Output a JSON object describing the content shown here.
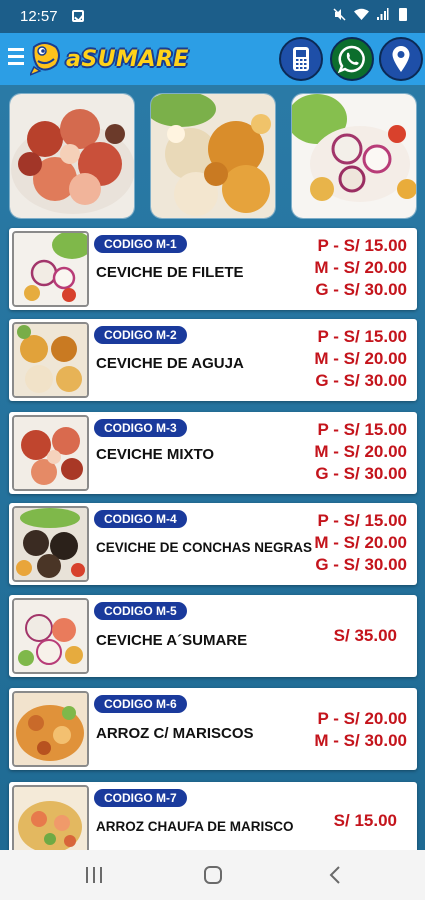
{
  "status_bar": {
    "time": "12:57"
  },
  "app_bar": {
    "logo_text": "aSUMARE",
    "actions": [
      {
        "name": "phone",
        "icon": "mobile-phone-icon"
      },
      {
        "name": "whatsapp",
        "icon": "whatsapp-icon"
      },
      {
        "name": "location",
        "icon": "map-pin-icon"
      }
    ]
  },
  "colors": {
    "app_bar": "#2c9ee5",
    "background": "#1f6a93",
    "badge": "#1a3a9c",
    "price": "#c4141c"
  },
  "menu_items": [
    {
      "code": "CODIGO M-1",
      "name": "CEVICHE DE FILETE",
      "prices": [
        "P -  S/ 15.00",
        "M - S/ 20.00",
        "G - S/ 30.00"
      ]
    },
    {
      "code": "CODIGO M-2",
      "name": "CEVICHE DE AGUJA",
      "prices": [
        "P -  S/ 15.00",
        "M - S/ 20.00",
        "G - S/ 30.00"
      ]
    },
    {
      "code": "CODIGO M-3",
      "name": "CEVICHE MIXTO",
      "prices": [
        "P -  S/ 15.00",
        "M - S/ 20.00",
        "G - S/ 30.00"
      ]
    },
    {
      "code": "CODIGO M-4",
      "name": "CEVICHE DE CONCHAS NEGRAS",
      "prices": [
        "P -  S/ 15.00",
        "M - S/ 20.00",
        "G - S/ 30.00"
      ]
    },
    {
      "code": "CODIGO M-5",
      "name": "CEVICHE A´SUMARE",
      "prices": [
        "S/ 35.00"
      ]
    },
    {
      "code": "CODIGO M-6",
      "name": "ARROZ C/ MARISCOS",
      "prices": [
        "P -  S/ 20.00",
        "M - S/ 30.00"
      ]
    },
    {
      "code": "CODIGO M-7",
      "name": "ARROZ CHAUFA DE MARISCO",
      "prices": [
        "S/ 15.00"
      ]
    }
  ]
}
